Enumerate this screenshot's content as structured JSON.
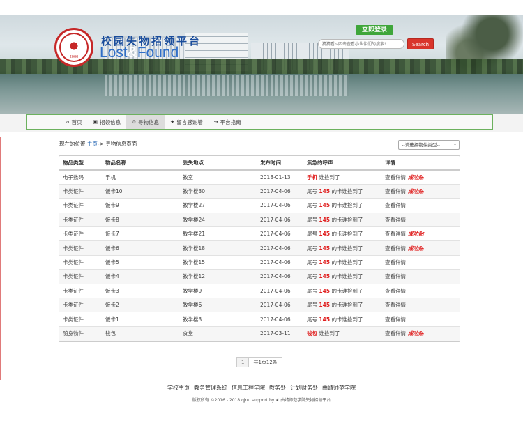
{
  "header": {
    "title": "校园失物招领平台",
    "subtitle_part1": "Lost",
    "subtitle_part2": "&",
    "subtitle_part3": "Found",
    "logo_year": "2000",
    "login_label": "立即登录",
    "search_placeholder": "猜猜看~四击查看小伙伴们的搜索!",
    "search_label": "Search"
  },
  "nav": {
    "items": [
      {
        "label": "首页",
        "icon": "home-icon",
        "glyph": "⌂"
      },
      {
        "label": "招领信息",
        "icon": "picture-icon",
        "glyph": "▣"
      },
      {
        "label": "寻物信息",
        "icon": "search-icon",
        "glyph": "⊙"
      },
      {
        "label": "留言感谢墙",
        "icon": "star-icon",
        "glyph": "★"
      },
      {
        "label": "平台指南",
        "icon": "share-icon",
        "glyph": "↪"
      }
    ]
  },
  "breadcrumb": {
    "prefix": "现在的位置",
    "home": "主页",
    "sep": "->",
    "current": "寻物信息页面"
  },
  "type_select": {
    "selected": "--请选择物件类型--"
  },
  "table": {
    "headers": [
      "物品类型",
      "物品名称",
      "丢失地点",
      "发布时间",
      "焦急的呼声",
      "详情"
    ],
    "rows": [
      {
        "type": "电子数码",
        "name": "手机",
        "place": "教室",
        "time": "2018-01-13",
        "call_pre": "",
        "call_hl": "手机",
        "call_post": "谁捡到了",
        "detail": "查看详情",
        "status": "成功贴"
      },
      {
        "type": "卡类证件",
        "name": "饭卡10",
        "place": "教学楼30",
        "time": "2017-04-06",
        "call_pre": "尾号",
        "call_hl": "145",
        "call_post": "的卡谁捡到了",
        "detail": "查看详情",
        "status": "成功贴"
      },
      {
        "type": "卡类证件",
        "name": "饭卡9",
        "place": "教学楼27",
        "time": "2017-04-06",
        "call_pre": "尾号",
        "call_hl": "145",
        "call_post": "的卡谁捡到了",
        "detail": "查看详情",
        "status": ""
      },
      {
        "type": "卡类证件",
        "name": "饭卡8",
        "place": "教学楼24",
        "time": "2017-04-06",
        "call_pre": "尾号",
        "call_hl": "145",
        "call_post": "的卡谁捡到了",
        "detail": "查看详情",
        "status": ""
      },
      {
        "type": "卡类证件",
        "name": "饭卡7",
        "place": "教学楼21",
        "time": "2017-04-06",
        "call_pre": "尾号",
        "call_hl": "145",
        "call_post": "的卡谁捡到了",
        "detail": "查看详情",
        "status": "成功贴"
      },
      {
        "type": "卡类证件",
        "name": "饭卡6",
        "place": "教学楼18",
        "time": "2017-04-06",
        "call_pre": "尾号",
        "call_hl": "145",
        "call_post": "的卡谁捡到了",
        "detail": "查看详情",
        "status": "成功贴"
      },
      {
        "type": "卡类证件",
        "name": "饭卡5",
        "place": "教学楼15",
        "time": "2017-04-06",
        "call_pre": "尾号",
        "call_hl": "145",
        "call_post": "的卡谁捡到了",
        "detail": "查看详情",
        "status": ""
      },
      {
        "type": "卡类证件",
        "name": "饭卡4",
        "place": "教学楼12",
        "time": "2017-04-06",
        "call_pre": "尾号",
        "call_hl": "145",
        "call_post": "的卡谁捡到了",
        "detail": "查看详情",
        "status": ""
      },
      {
        "type": "卡类证件",
        "name": "饭卡3",
        "place": "教学楼9",
        "time": "2017-04-06",
        "call_pre": "尾号",
        "call_hl": "145",
        "call_post": "的卡谁捡到了",
        "detail": "查看详情",
        "status": ""
      },
      {
        "type": "卡类证件",
        "name": "饭卡2",
        "place": "教学楼6",
        "time": "2017-04-06",
        "call_pre": "尾号",
        "call_hl": "145",
        "call_post": "的卡谁捡到了",
        "detail": "查看详情",
        "status": ""
      },
      {
        "type": "卡类证件",
        "name": "饭卡1",
        "place": "教学楼3",
        "time": "2017-04-06",
        "call_pre": "尾号",
        "call_hl": "145",
        "call_post": "的卡谁捡到了",
        "detail": "查看详情",
        "status": ""
      },
      {
        "type": "随身物件",
        "name": "钱包",
        "place": "食堂",
        "time": "2017-03-11",
        "call_pre": "",
        "call_hl": "钱包",
        "call_post": "谁捡到了",
        "detail": "查看详情",
        "status": "成功贴"
      }
    ]
  },
  "pager": {
    "current": "1",
    "summary": "共1页12条"
  },
  "footer": {
    "links": [
      "学校主页",
      "教务管理系统",
      "信息工程学院",
      "教务处",
      "计划财务处",
      "曲靖师范学院"
    ],
    "copyright": "版权所有 ©2016 - 2018 qjnu support by",
    "platform": "曲靖师范学院失物招领平台"
  },
  "colors": {
    "accent_red": "#e02020",
    "login_green": "#3fa63a",
    "search_red": "#d9352b",
    "nav_border": "#6cb15e",
    "frame_border": "#e07a7a"
  }
}
